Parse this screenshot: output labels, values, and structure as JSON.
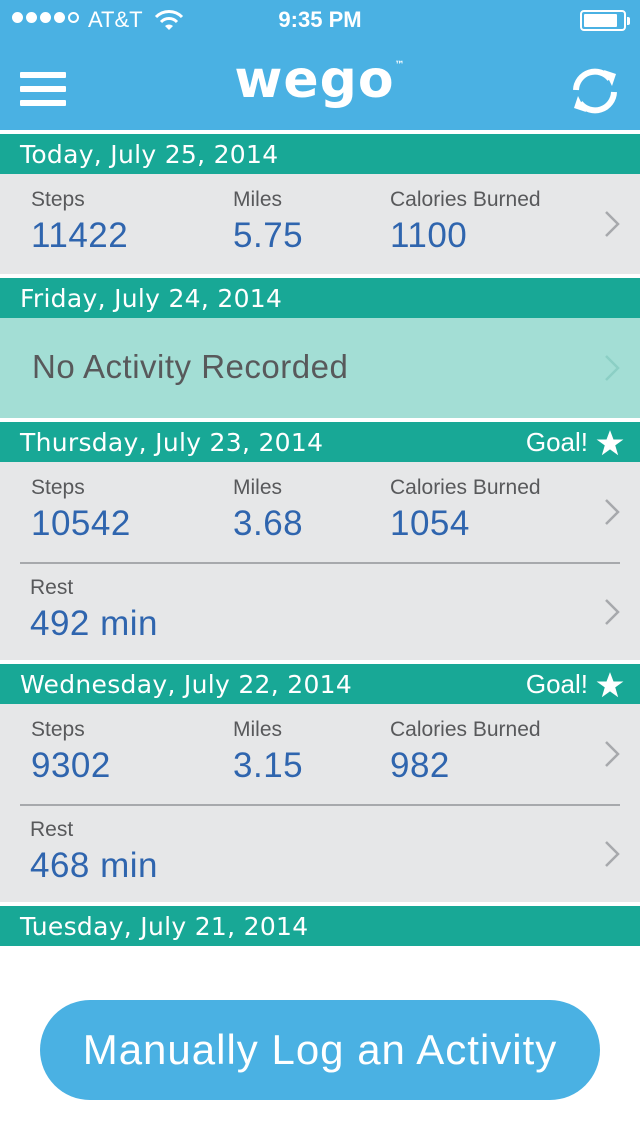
{
  "status_bar": {
    "carrier": "AT&T",
    "time": "9:35 PM"
  },
  "header": {
    "logo": "wego",
    "logo_tm": "™"
  },
  "days": [
    {
      "date": "Today, July 25, 2014",
      "goal": "",
      "steps_label": "Steps",
      "steps": "11422",
      "miles_label": "Miles",
      "miles": "5.75",
      "calories_label": "Calories Burned",
      "calories": "1100"
    },
    {
      "date": "Friday, July 24, 2014",
      "no_activity": "No Activity Recorded"
    },
    {
      "date": "Thursday, July 23, 2014",
      "goal": "Goal!",
      "steps_label": "Steps",
      "steps": "10542",
      "miles_label": "Miles",
      "miles": "3.68",
      "calories_label": "Calories Burned",
      "calories": "1054",
      "rest_label": "Rest",
      "rest": "492 min"
    },
    {
      "date": "Wednesday, July 22, 2014",
      "goal": "Goal!",
      "steps_label": "Steps",
      "steps": "9302",
      "miles_label": "Miles",
      "miles": "3.15",
      "calories_label": "Calories Burned",
      "calories": "982",
      "rest_label": "Rest",
      "rest": "468 min"
    },
    {
      "date": "Tuesday, July 21, 2014"
    }
  ],
  "log_button": "Manually Log an Activity",
  "colors": {
    "header": "#4ab1e3",
    "day_header": "#18a896",
    "card": "#e6e7e8",
    "no_activity": "#a3ded5",
    "value": "#2f65ae"
  }
}
